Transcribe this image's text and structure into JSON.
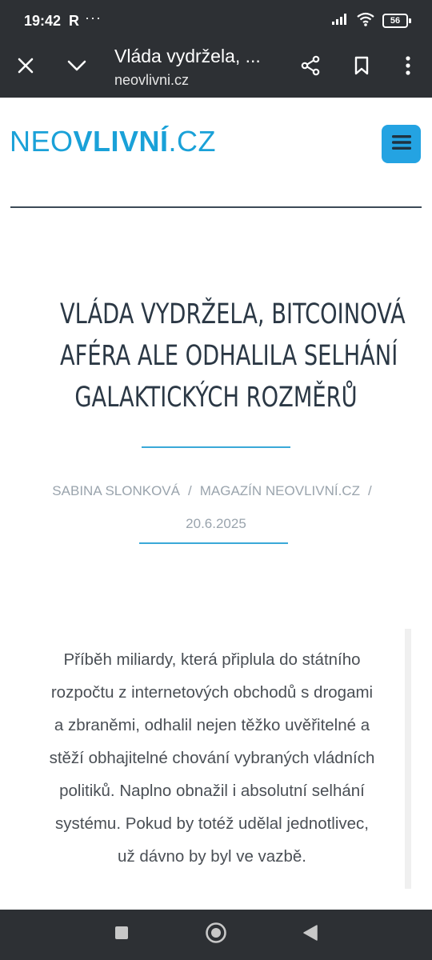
{
  "status_bar": {
    "time": "19:42",
    "r_indicator": "R",
    "more_indicator": "···",
    "battery_level": "56"
  },
  "browser": {
    "page_title": "Vláda vydržela, ...",
    "url": "neovlivni.cz"
  },
  "site": {
    "logo_light": "NEO",
    "logo_bold": "VLIVNÍ",
    "logo_suffix": ".CZ",
    "accent_color": "#1aa1d8"
  },
  "article": {
    "headline_lines": [
      "VLÁDA VYDRŽELA, BITCOINOVÁ",
      "AFÉRA ALE ODHALILA SELHÁNÍ",
      "GALAKTICKÝCH ROZMĚRŮ"
    ],
    "author": "SABINA SLONKOVÁ",
    "separator": "/",
    "category": "MAGAZÍN NEOVLIVNÍ.CZ",
    "date": "20.6.2025",
    "lead_lines": [
      "Příběh miliardy, která připlula do státního",
      "rozpočtu z internetových obchodů s drogami",
      "a zbraněmi, odhalil nejen těžko uvěřitelné a",
      "stěží obhajitelné chování vybraných vládních",
      "politiků. Naplno obnažil i absolutní selhání",
      "systému. Pokud by totéž udělal jednotlivec,",
      "už dávno by byl ve vazbě."
    ]
  }
}
